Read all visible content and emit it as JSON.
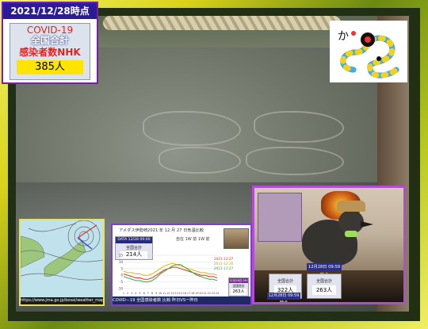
{
  "covid": {
    "date": "2021/12/28時点",
    "line1": "COVID-19",
    "line2": "全国合計",
    "line3": "感染者数NHK",
    "count": "385人"
  },
  "weather_map": {
    "url": "https://www.jma.go.jp/bosai/weather_map/"
  },
  "chart_panel": {
    "title": "アメダス伊勢崎2021 年 12 月 27 日気温比較",
    "tabs": "自在 1W 前 1W 前",
    "mini_header": "DATA 12/28 09:00",
    "mini_label": "全国合計",
    "mini_value": "214人",
    "right_header": "12月28日 09:50",
    "right_label": "全国合計",
    "right_value": "263人",
    "bottom_caption": "COVID－19 全国感染者数 比較 昨日VS一昨日",
    "legend": [
      "2021-12-27",
      "2021-12-26",
      "2021-11-27"
    ]
  },
  "chart_data": {
    "type": "line",
    "title": "アメダス伊勢崎2021 年 12 月 27 日気温比較",
    "x": [
      1,
      2,
      3,
      4,
      5,
      6,
      7,
      8,
      9,
      10,
      11,
      12,
      13,
      14,
      15,
      16,
      17,
      18,
      19,
      20,
      21,
      22,
      23,
      24
    ],
    "ylim": [
      -10,
      15
    ],
    "y_ticks": [
      15,
      10,
      5,
      0,
      -5,
      -10
    ],
    "series": [
      {
        "name": "2021-12-27",
        "color": "#e0312b",
        "values": [
          1,
          0,
          -1,
          -2,
          -2,
          -3,
          -3,
          -2,
          0,
          2,
          4,
          5,
          6,
          6,
          5,
          4,
          3,
          2,
          1,
          0,
          0,
          -1,
          -1,
          -2
        ]
      },
      {
        "name": "2021-12-26",
        "color": "#e5b800",
        "values": [
          3,
          2,
          2,
          1,
          1,
          0,
          0,
          1,
          3,
          5,
          7,
          8,
          9,
          8,
          7,
          6,
          5,
          4,
          3,
          2,
          2,
          1,
          1,
          0
        ]
      },
      {
        "name": "2021-11-27",
        "color": "#3da832",
        "values": [
          -1,
          -2,
          -3,
          -4,
          -4,
          -5,
          -5,
          -4,
          -2,
          1,
          3,
          5,
          7,
          8,
          8,
          6,
          4,
          2,
          0,
          -1,
          -2,
          -3,
          -3,
          -4
        ]
      }
    ]
  },
  "bird_scene": {
    "box1_label": "全国合計",
    "box1_value": "322人",
    "box1_stamp": "12月28日 09:59 時点",
    "box2_header": "12月28日 09:59 時点",
    "box2_label": "全国合計",
    "box2_value": "263人"
  },
  "colors": {
    "frame": "#d9d21a",
    "covid_header": "#2b1b99",
    "accent_purple": "#7a1bb3",
    "count_bg": "#ffe400"
  }
}
